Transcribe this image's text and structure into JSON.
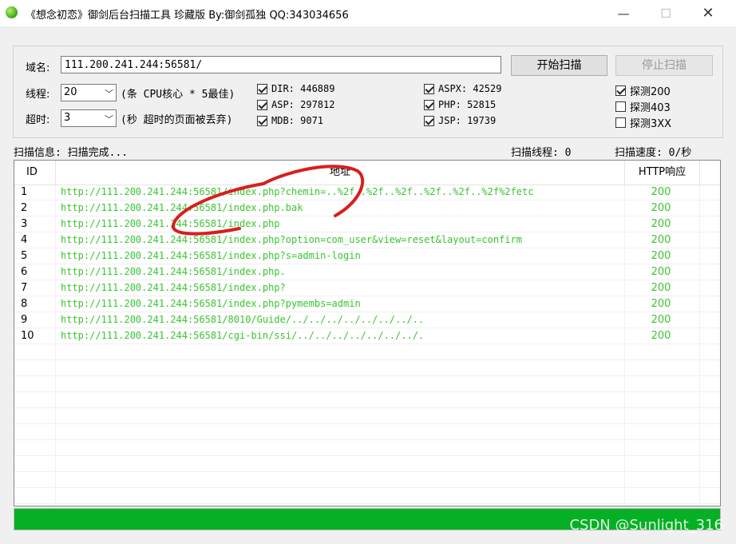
{
  "window": {
    "title": "《想念初恋》御剑后台扫描工具 珍藏版 By:御剑孤独 QQ:343034656",
    "icons": [
      "app-icon",
      "minimize-icon",
      "maximize-icon",
      "close-icon"
    ]
  },
  "form": {
    "domain_label": "域名:",
    "domain_value": "111.200.241.244:56581/",
    "start_button": "开始扫描",
    "stop_button": "停止扫描",
    "threads_label": "线程:",
    "threads_value": "20",
    "threads_hint": "(条 CPU核心 * 5最佳)",
    "timeout_label": "超时:",
    "timeout_value": "3",
    "timeout_hint": "(秒 超时的页面被丢弃)"
  },
  "dictionaries": [
    {
      "label": "DIR: 446889",
      "checked": true
    },
    {
      "label": "ASP: 297812",
      "checked": true
    },
    {
      "label": "MDB: 9071",
      "checked": true
    },
    {
      "label": "ASPX: 42529",
      "checked": true
    },
    {
      "label": "PHP: 52815",
      "checked": true
    },
    {
      "label": "JSP: 19739",
      "checked": true
    }
  ],
  "probes": [
    {
      "label": "探测200",
      "checked": true
    },
    {
      "label": "探测403",
      "checked": false
    },
    {
      "label": "探测3XX",
      "checked": false
    }
  ],
  "status": {
    "info": "扫描信息: 扫描完成...",
    "threads": "扫描线程: 0",
    "speed": "扫描速度: 0/秒"
  },
  "table": {
    "headers": {
      "id": "ID",
      "url": "地址",
      "code": "HTTP响应"
    },
    "rows": [
      {
        "id": "1",
        "url": "http://111.200.241.244:56581/index.php?chemin=..%2f..%2f..%2f..%2f..%2f..%2f%2fetc",
        "code": "200"
      },
      {
        "id": "2",
        "url": "http://111.200.241.244:56581/index.php.bak",
        "code": "200"
      },
      {
        "id": "3",
        "url": "http://111.200.241.244:56581/index.php",
        "code": "200"
      },
      {
        "id": "4",
        "url": "http://111.200.241.244:56581/index.php?option=com_user&view=reset&layout=confirm",
        "code": "200"
      },
      {
        "id": "5",
        "url": "http://111.200.241.244:56581/index.php?s=admin-login",
        "code": "200"
      },
      {
        "id": "6",
        "url": "http://111.200.241.244:56581/index.php.",
        "code": "200"
      },
      {
        "id": "7",
        "url": "http://111.200.241.244:56581/index.php?",
        "code": "200"
      },
      {
        "id": "8",
        "url": "http://111.200.241.244:56581/index.php?pymembs=admin",
        "code": "200"
      },
      {
        "id": "9",
        "url": "http://111.200.241.244:56581/8010/Guide/../../../../../../../..",
        "code": "200"
      },
      {
        "id": "10",
        "url": "http://111.200.241.244:56581/cgi-bin/ssi/../../../../../../../.",
        "code": "200"
      }
    ],
    "empty_rows": 10
  },
  "progress": {
    "value": 1.0
  },
  "watermark": "CSDN @Sunlight_316",
  "colors": {
    "url_green": "#39c52f",
    "progress_green": "#06b025",
    "annotation_red": "#d81e1e"
  }
}
